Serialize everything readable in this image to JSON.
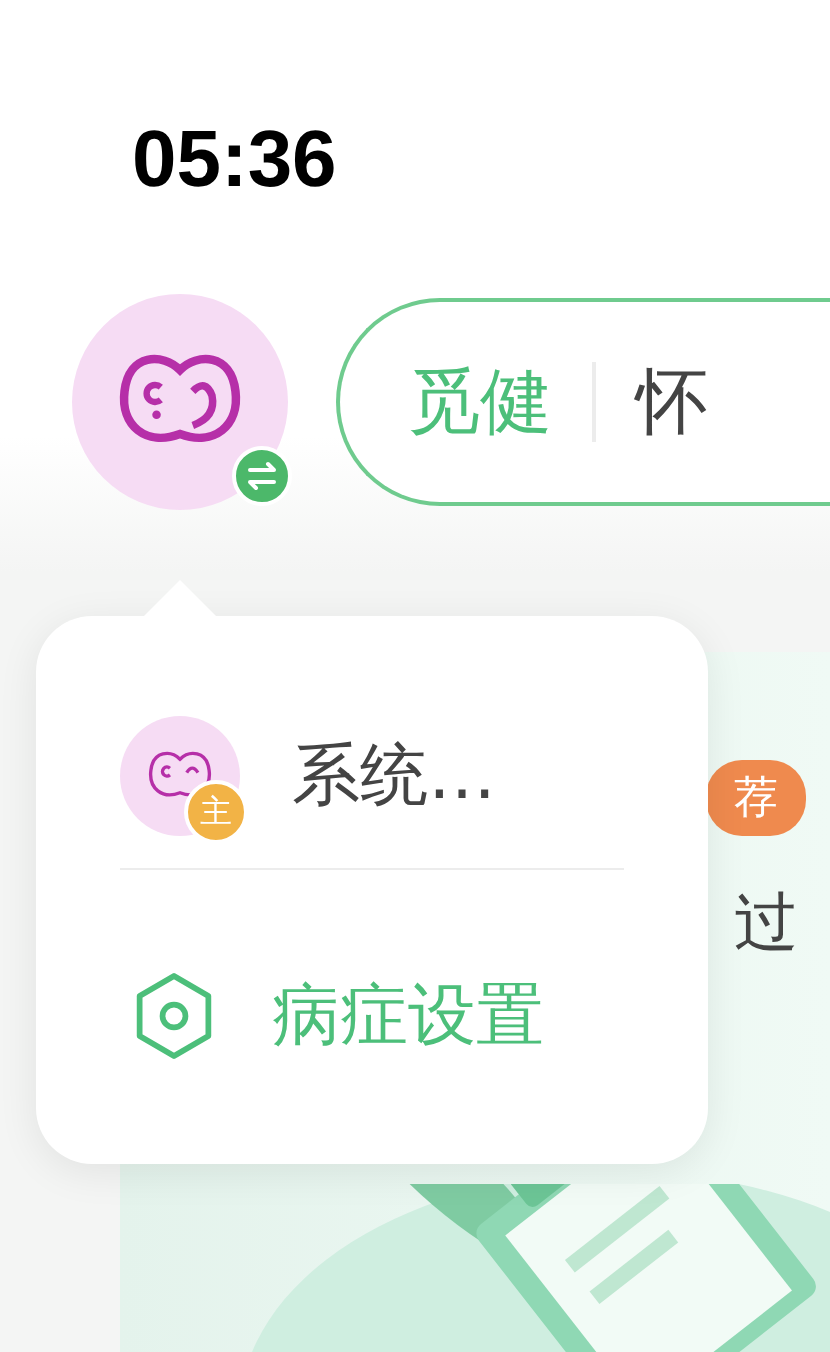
{
  "status_bar": {
    "time": "05:36"
  },
  "search": {
    "tabs": [
      {
        "label": "觅健",
        "selected": true
      },
      {
        "label": "怀",
        "selected": false
      }
    ]
  },
  "content": {
    "badge": "荐",
    "text": "过"
  },
  "popup": {
    "items": [
      {
        "kind": "account",
        "label": "系统…",
        "badge": "主"
      },
      {
        "kind": "settings",
        "label": "病症设置"
      }
    ]
  }
}
